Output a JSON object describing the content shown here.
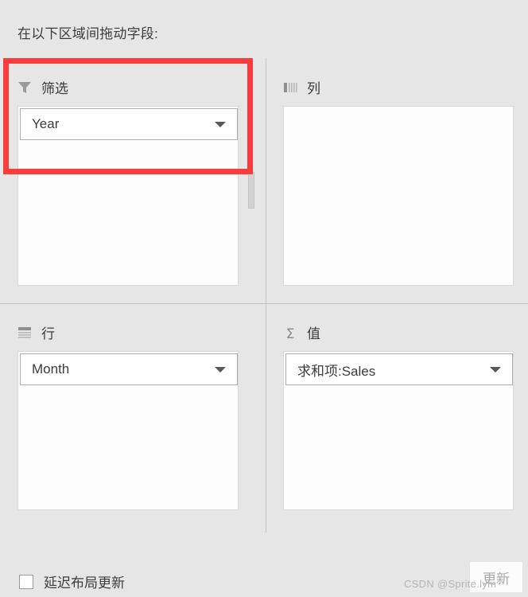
{
  "header": {
    "title": "在以下区域间拖动字段:"
  },
  "zones": {
    "filters": {
      "label": "筛选",
      "icon": "funnel-icon",
      "field": "Year"
    },
    "columns": {
      "label": "列",
      "icon": "columns-icon",
      "field": ""
    },
    "rows": {
      "label": "行",
      "icon": "rows-icon",
      "field": "Month"
    },
    "values": {
      "label": "值",
      "icon": "sigma-icon",
      "icon_glyph": "Σ",
      "field": "求和项:Sales"
    }
  },
  "footer": {
    "defer_label": "延迟布局更新",
    "defer_checked": false,
    "update_label": "更新"
  },
  "watermark": {
    "text": "CSDN @Sprite.lym"
  },
  "colors": {
    "panel_bg": "#e6e6e6",
    "drop_bg": "#fdfdfd",
    "text": "#3c3c3c",
    "icon_gray": "#8a8a8a",
    "highlight_red": "#fa3c3c",
    "divider": "#c2c2c2",
    "disabled_text": "#a8a8a8"
  }
}
